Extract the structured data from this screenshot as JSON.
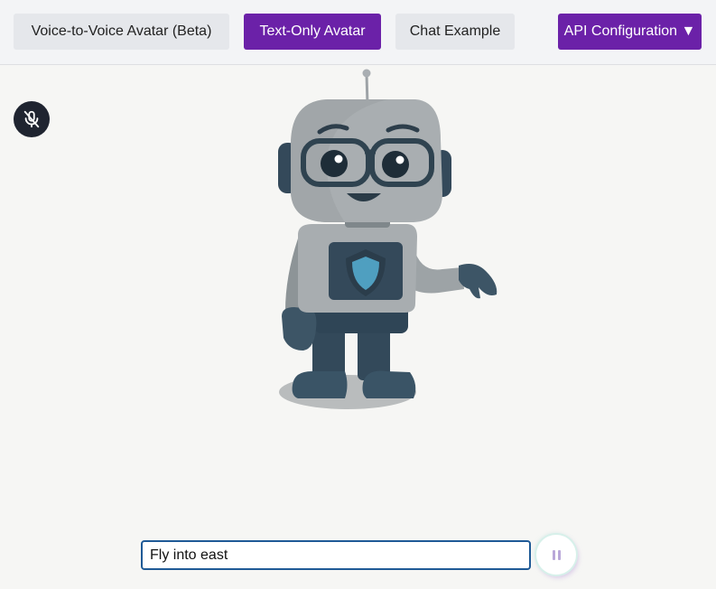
{
  "header": {
    "tabs": [
      {
        "label": "Voice-to-Voice Avatar (Beta)",
        "active": false
      },
      {
        "label": "Text-Only Avatar",
        "active": true
      },
      {
        "label": "Chat Example",
        "active": false
      }
    ],
    "api_config_label": "API Configuration ▼"
  },
  "controls": {
    "mic_icon": "mic-off-icon",
    "pause_icon": "pause-icon"
  },
  "avatar": {
    "name": "robot-avatar"
  },
  "input": {
    "value": "Fly into east"
  },
  "colors": {
    "accent": "#6b21a8",
    "tab_inactive": "#e5e7eb",
    "input_border": "#1f5a96",
    "mic_button": "#1f2430"
  }
}
